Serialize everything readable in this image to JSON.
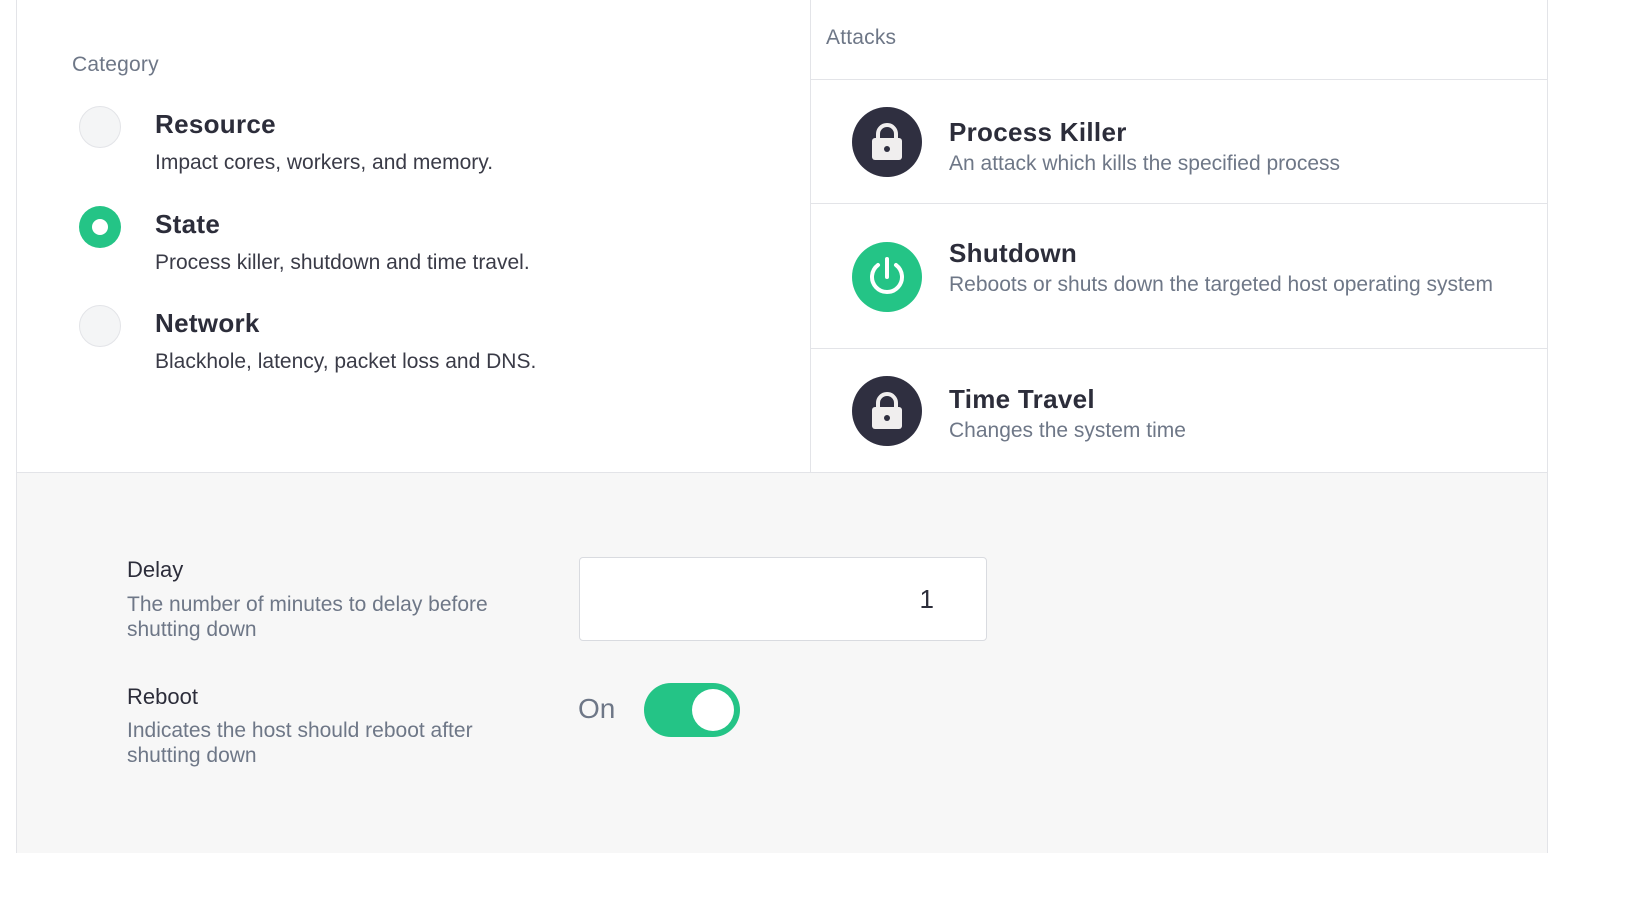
{
  "category": {
    "label": "Category",
    "items": [
      {
        "title": "Resource",
        "description": "Impact cores, workers, and memory.",
        "selected": false
      },
      {
        "title": "State",
        "description": "Process killer, shutdown and time travel.",
        "selected": true
      },
      {
        "title": "Network",
        "description": "Blackhole, latency, packet loss and DNS.",
        "selected": false
      }
    ]
  },
  "attacks": {
    "label": "Attacks",
    "items": [
      {
        "title": "Process Killer",
        "description": "An attack which kills the specified process",
        "icon": "lock-icon",
        "locked": true
      },
      {
        "title": "Shutdown",
        "description": "Reboots or shuts down the targeted host operating system",
        "icon": "power-icon",
        "locked": false
      },
      {
        "title": "Time Travel",
        "description": "Changes the system time",
        "icon": "lock-icon",
        "locked": true
      }
    ]
  },
  "settings": {
    "delay": {
      "label": "Delay",
      "description": "The number of minutes to delay before shutting down",
      "value": "1"
    },
    "reboot": {
      "label": "Reboot",
      "description": "Indicates the host should reboot after shutting down",
      "state_label": "On",
      "enabled": true
    }
  },
  "colors": {
    "accent": "#24c486",
    "icon_dark": "#2f2f40",
    "muted_text": "#6e7787",
    "text": "#2c2d3a"
  }
}
